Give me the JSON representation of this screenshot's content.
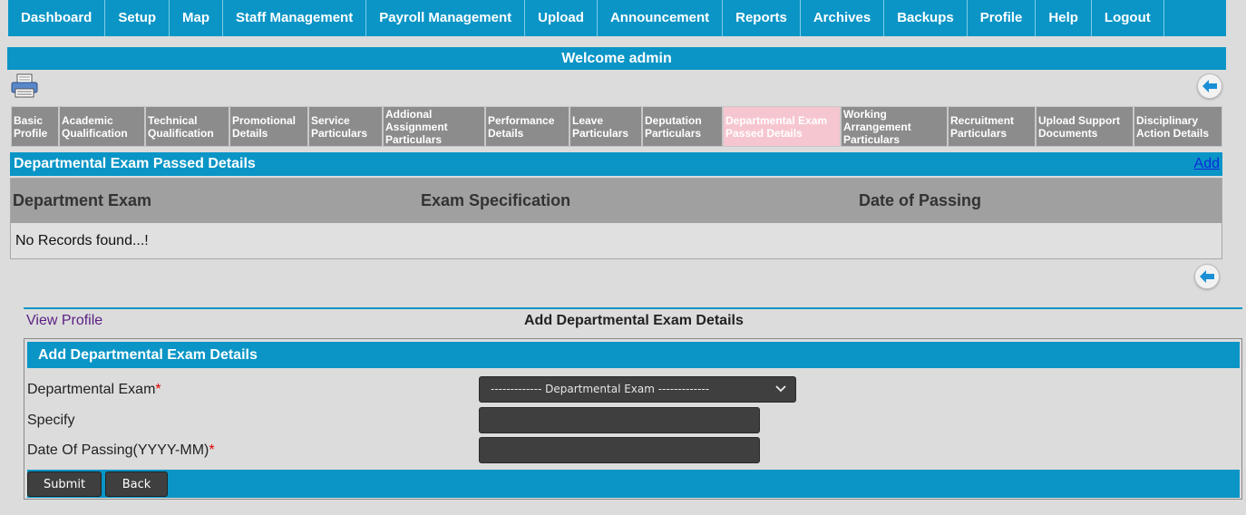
{
  "nav": [
    "Dashboard",
    "Setup",
    "Map",
    "Staff Management",
    "Payroll Management",
    "Upload",
    "Announcement",
    "Reports",
    "Archives",
    "Backups",
    "Profile",
    "Help",
    "Logout"
  ],
  "welcome": "Welcome admin",
  "tabs": [
    {
      "label": "Basic Profile",
      "active": false
    },
    {
      "label": "Academic Qualification",
      "active": false
    },
    {
      "label": "Technical Qualification",
      "active": false
    },
    {
      "label": "Promotional Details",
      "active": false
    },
    {
      "label": "Service Particulars",
      "active": false
    },
    {
      "label": "Addional Assignment Particulars",
      "active": false
    },
    {
      "label": "Performance Details",
      "active": false
    },
    {
      "label": "Leave Particulars",
      "active": false
    },
    {
      "label": "Deputation Particulars",
      "active": false
    },
    {
      "label": "Departmental Exam Passed Details",
      "active": true
    },
    {
      "label": "Working Arrangement Particulars",
      "active": false
    },
    {
      "label": "Recruitment Particulars",
      "active": false
    },
    {
      "label": "Upload Support Documents",
      "active": false
    },
    {
      "label": "Disciplinary Action Details",
      "active": false
    }
  ],
  "records": {
    "title": "Departmental Exam Passed Details",
    "add_label": "Add",
    "columns": [
      "Department Exam",
      "Exam Specification",
      "Date of Passing"
    ],
    "empty_text": "No Records found...!"
  },
  "view_profile": "View Profile",
  "form": {
    "heading": "Add Departmental Exam Details",
    "box_title": "Add Departmental Exam Details",
    "exam_label": "Departmental Exam",
    "exam_placeholder": "------------- Departmental Exam -------------",
    "specify_label": "Specify",
    "date_label": "Date Of Passing(YYYY-MM)",
    "required_mark": "*",
    "submit_label": "Submit",
    "back_label": "Back"
  }
}
